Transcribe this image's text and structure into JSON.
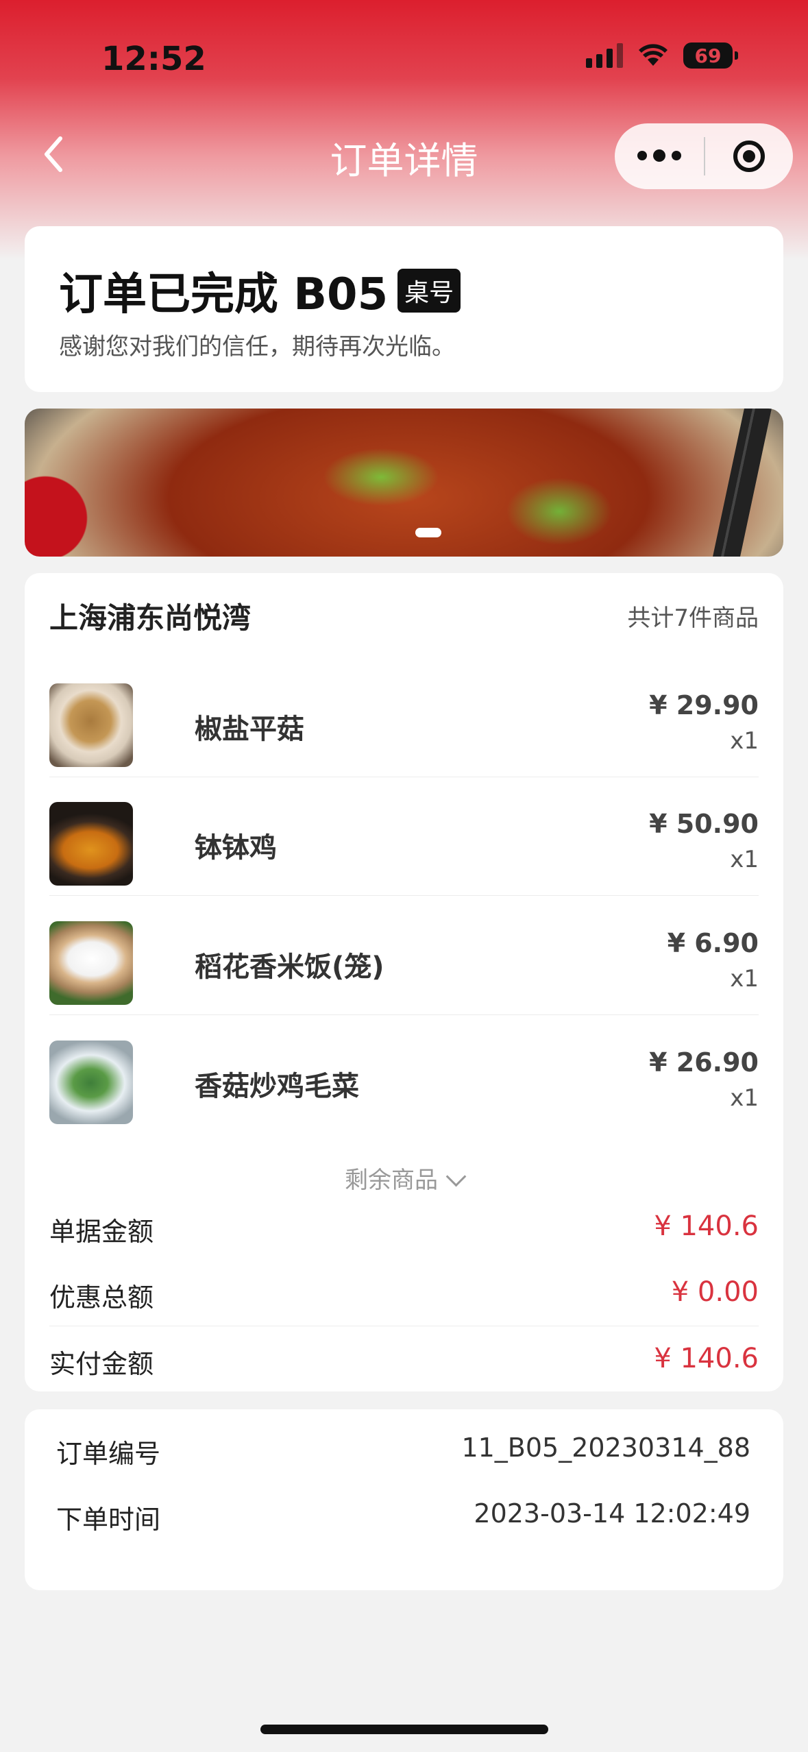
{
  "status_bar": {
    "time": "12:52",
    "battery": "69"
  },
  "nav": {
    "title": "订单详情"
  },
  "order_status": {
    "title": "订单已完成 B05",
    "table_tag": "桌号",
    "subtitle": "感谢您对我们的信任，期待再次光临。"
  },
  "store": {
    "name": "上海浦东尚悦湾",
    "item_count": "共计7件商品"
  },
  "items": [
    {
      "name": "椒盐平菇",
      "price": "¥ 29.90",
      "qty": "x1"
    },
    {
      "name": "钵钵鸡",
      "price": "¥ 50.90",
      "qty": "x1"
    },
    {
      "name": "稻花香米饭(笼)",
      "price": "¥ 6.90",
      "qty": "x1"
    },
    {
      "name": "香菇炒鸡毛菜",
      "price": "¥ 26.90",
      "qty": "x1"
    }
  ],
  "more_items_label": "剩余商品",
  "summary": {
    "bill_label": "单据金额",
    "bill_value": "¥ 140.6",
    "discount_label": "优惠总额",
    "discount_value": "¥ 0.00",
    "paid_label": "实付金额",
    "paid_value": "¥ 140.6"
  },
  "info": {
    "order_no_label": "订单编号",
    "order_no_value": "11_B05_20230314_88",
    "order_time_label": "下单时间",
    "order_time_value": "2023-03-14 12:02:49"
  },
  "colors": {
    "accent": "#d9333f",
    "header_red": "#dc1f2e"
  }
}
